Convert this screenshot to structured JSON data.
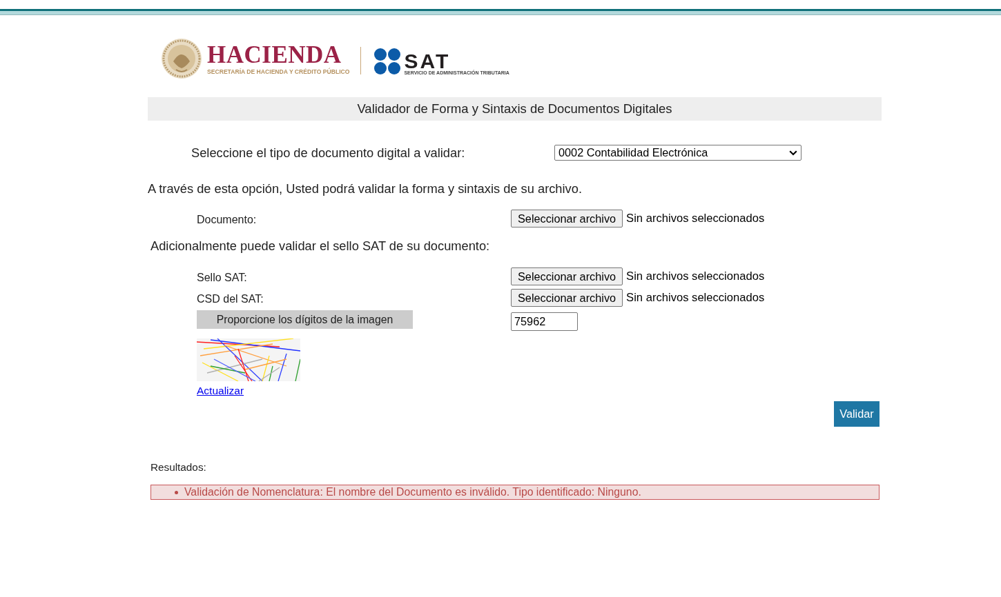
{
  "header": {
    "hacienda_logo": {
      "name": "HACIENDA",
      "subtitle": "SECRETARÍA DE HACIENDA Y CRÉDITO PÚBLICO"
    },
    "sat_logo": {
      "name": "SAT",
      "subtitle": "SERVICIO DE ADMINISTRACIÓN TRIBUTARIA"
    }
  },
  "title": "Validador de Forma y Sintaxis de Documentos Digitales",
  "document_type": {
    "label": "Seleccione el tipo de documento digital a validar:",
    "value": "0002 Contabilidad Electrónica"
  },
  "sections": [
    {
      "intro": "A través de esta opción, Usted podrá validar la forma y sintaxis de su archivo.",
      "files": [
        {
          "label": "Documento:",
          "button": "Seleccionar archivo",
          "status": "Sin archivos seleccionados"
        }
      ]
    },
    {
      "intro": "Adicionalmente puede validar el sello SAT de su documento:",
      "files": [
        {
          "label": "Sello SAT:",
          "button": "Seleccionar archivo",
          "status": "Sin archivos seleccionados"
        },
        {
          "label": "CSD del SAT:",
          "button": "Seleccionar archivo",
          "status": "Sin archivos seleccionados"
        }
      ]
    }
  ],
  "captcha": {
    "prompt": "Proporcione los dígitos de la imagen",
    "value": "75962",
    "refresh_link": "Actualizar"
  },
  "submit_button": "Validar",
  "results": {
    "label": "Resultados:",
    "errors": [
      "Validación de Nomenclatura: El nombre del Documento es inválido. Tipo identificado: Ninguno."
    ]
  }
}
